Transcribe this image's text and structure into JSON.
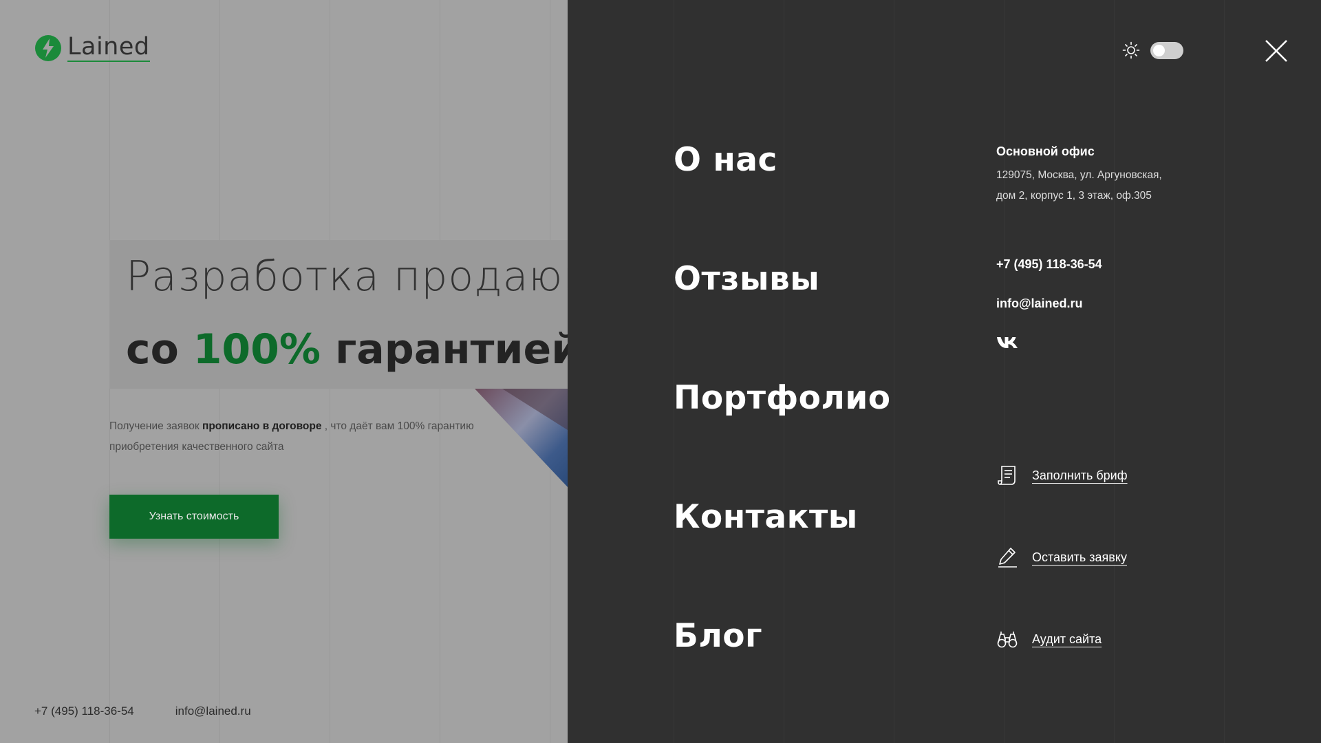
{
  "brand": {
    "name": "Lained",
    "mark_color": "#1b8a3a"
  },
  "hero": {
    "line1": "Разработка продающ",
    "line2_start": "со ",
    "line2_accent": "100%",
    "line2_end": " гарантией",
    "accent_color": "#0d6a2a",
    "sub_before": "Получение заявок ",
    "sub_bold": "прописано в договоре",
    "sub_after": " , что даёт вам 100% гарантию приобретения качественного сайта",
    "cta_label": "Узнать стоимость"
  },
  "page_footer": {
    "phone": "+7 (495) 118-36-54",
    "email": "info@lained.ru"
  },
  "menu": {
    "theme_toggle_state": "light",
    "nav": [
      {
        "label": "О нас"
      },
      {
        "label": "Отзывы"
      },
      {
        "label": "Портфолио"
      },
      {
        "label": "Контакты"
      },
      {
        "label": "Блог"
      }
    ],
    "contacts": {
      "office_title": "Основной офис",
      "address_line1": "129075, Москва, ул. Аргуновская,",
      "address_line2": "дом 2, корпус 1, 3 этаж, оф.305",
      "phone": "+7 (495) 118-36-54",
      "email": "info@lained.ru",
      "social_icon": "vk-icon"
    },
    "actions": [
      {
        "label": "Заполнить бриф",
        "icon": "document-icon"
      },
      {
        "label": "Оставить заявку",
        "icon": "pencil-icon"
      },
      {
        "label": "Аудит сайта",
        "icon": "binoculars-icon"
      }
    ]
  },
  "colors": {
    "panel_bg": "#303030",
    "page_bg": "#a2a2a2",
    "brand_green": "#0d6a2a"
  }
}
